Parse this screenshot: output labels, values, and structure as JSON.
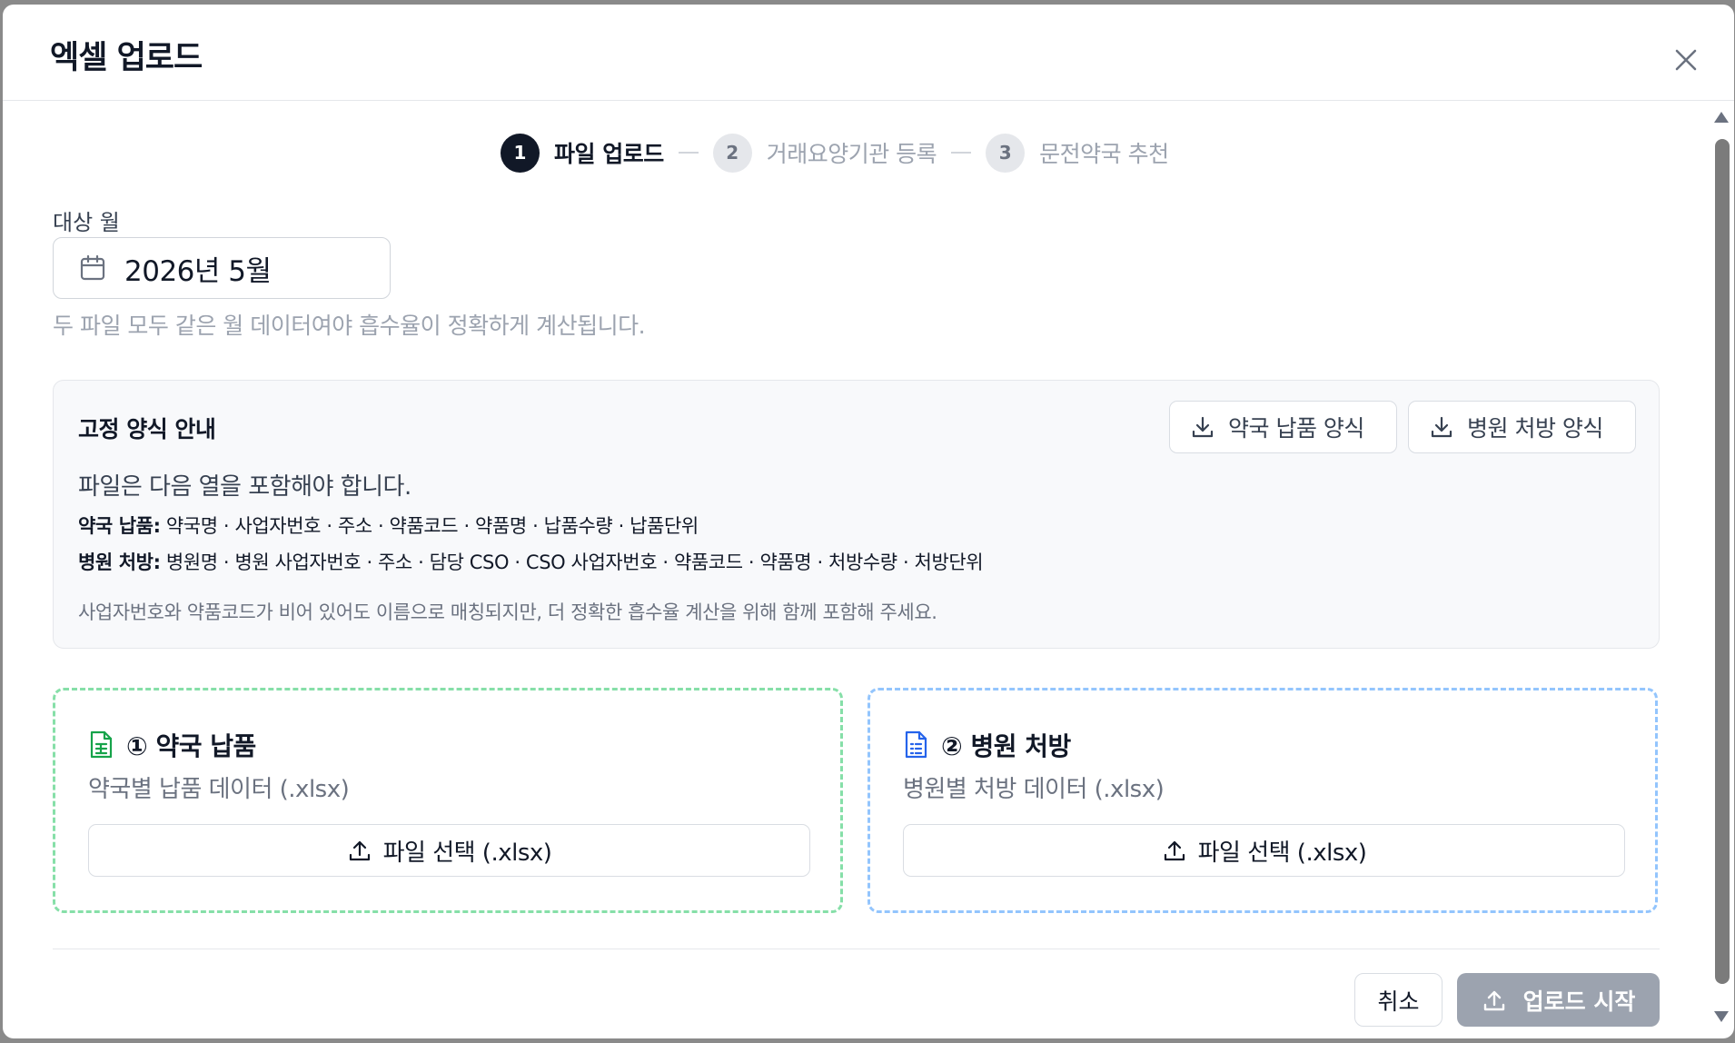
{
  "dialog": {
    "title": "엑셀 업로드",
    "close_icon": "close-icon"
  },
  "stepper": [
    {
      "num": "1",
      "label": "파일 업로드",
      "state": "active"
    },
    {
      "num": "2",
      "label": "거래요양기관 등록",
      "state": "inactive"
    },
    {
      "num": "3",
      "label": "문전약국 추천",
      "state": "inactive"
    }
  ],
  "month": {
    "label": "대상 월",
    "value": "2026년 5월",
    "icon": "calendar-icon",
    "help": "두 파일 모두 같은 월 데이터여야 흡수율이 정확하게 계산됩니다."
  },
  "guide": {
    "title": "고정 양식 안내",
    "download_pharmacy": "약국 납품 양식",
    "download_hospital": "병원 처방 양식",
    "intro": "파일은 다음 열을 포함해야 합니다.",
    "pharmacy_key": "약국 납품:",
    "pharmacy_cols": "약국명 · 사업자번호 · 주소 · 약품코드 · 약품명 · 납품수량 · 납품단위",
    "hospital_key": "병원 처방:",
    "hospital_cols": "병원명 · 병원 사업자번호 · 주소 · 담당 CSO · CSO 사업자번호 · 약품코드 · 약품명 · 처방수량 · 처방단위",
    "note": "사업자번호와 약품코드가 비어 있어도 이름으로 매칭되지만, 더 정확한 흡수율 계산을 위해 함께 포함해 주세요."
  },
  "cards": {
    "pharmacy": {
      "title": "① 약국 납품",
      "sub": "약국별 납품 데이터 (.xlsx)",
      "button": "파일 선택 (.xlsx)",
      "accent": "#16a34a"
    },
    "hospital": {
      "title": "② 병원 처방",
      "sub": "병원별 처방 데이터 (.xlsx)",
      "button": "파일 선택 (.xlsx)",
      "accent": "#2563eb"
    }
  },
  "footer": {
    "cancel": "취소",
    "start": "업로드 시작"
  }
}
